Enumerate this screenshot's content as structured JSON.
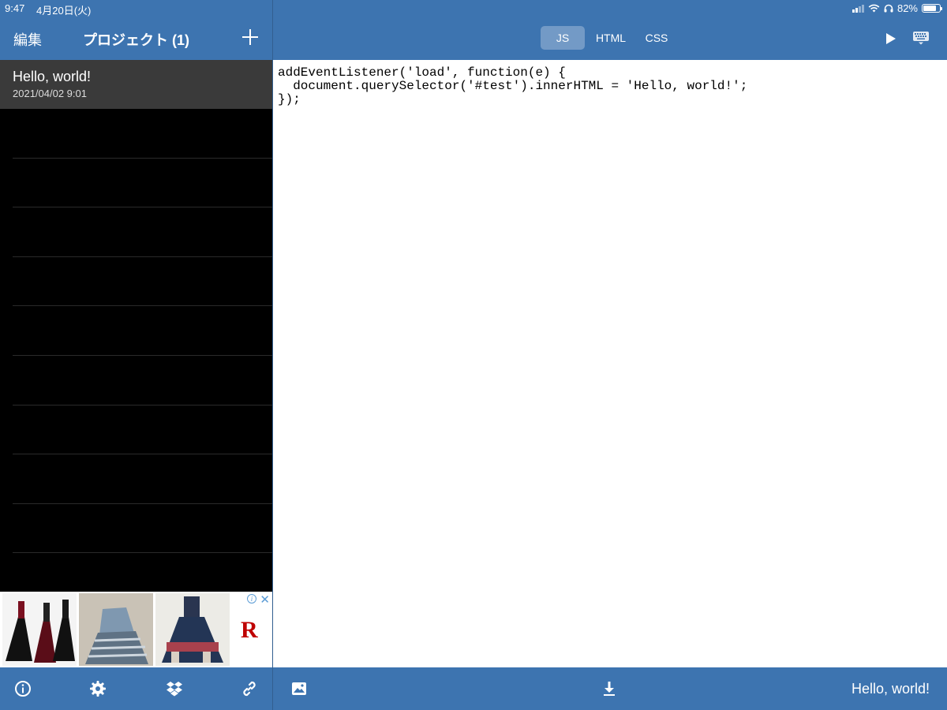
{
  "status_bar": {
    "time": "9:47",
    "date": "4月20日(火)",
    "battery": "82%",
    "battery_level": 0.82
  },
  "sidebar": {
    "edit_label": "編集",
    "title": "プロジェクト (1)",
    "projects": [
      {
        "name": "Hello, world!",
        "date": "2021/04/02 9:01"
      }
    ]
  },
  "editor": {
    "tabs": [
      {
        "label": "JS",
        "active": true
      },
      {
        "label": "HTML",
        "active": false
      },
      {
        "label": "CSS",
        "active": false
      }
    ],
    "code": "addEventListener('load', function(e) {\n  document.querySelector('#test').innerHTML = 'Hello, world!';\n});"
  },
  "footer": {
    "project_title": "Hello, world!"
  },
  "ad": {
    "logo": "R"
  },
  "icons": {
    "left_toolbar": [
      "info-icon",
      "gear-icon",
      "dropbox-icon",
      "link-icon"
    ],
    "right_toolbar": [
      "image-icon",
      "download-icon"
    ],
    "header": [
      "plus-icon",
      "play-icon",
      "keyboard-icon"
    ]
  },
  "colors": {
    "accent": "#3d74b0",
    "selected_row": "#3a3a3a",
    "list_bg": "#000000",
    "editor_bg": "#ffffff",
    "ad_logo": "#bf0000"
  }
}
